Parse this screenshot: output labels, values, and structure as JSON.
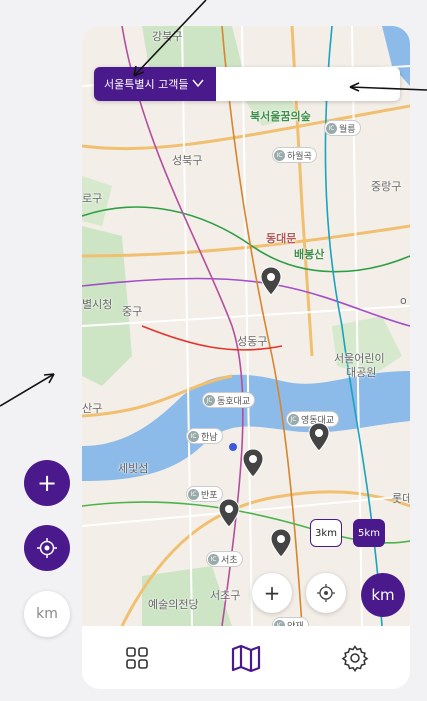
{
  "region_selector": {
    "label": "서울특별시 고객들",
    "chevron_icon": "chevron-down-icon"
  },
  "map_labels": [
    {
      "id": "gangbuk",
      "text": "강북구"
    },
    {
      "id": "seongbuk",
      "text": "성북구"
    },
    {
      "id": "jongno",
      "text": "로구"
    },
    {
      "id": "jungnang",
      "text": "중랑구"
    },
    {
      "id": "dongdaemun",
      "text": "동대문"
    },
    {
      "id": "baebongsan",
      "text": "배봉산"
    },
    {
      "id": "cityhall",
      "text": "별시청"
    },
    {
      "id": "junggu",
      "text": "중구"
    },
    {
      "id": "seongdong",
      "text": "성동구"
    },
    {
      "id": "childpark",
      "text": "서울어린이"
    },
    {
      "id": "childpark2",
      "text": "대공원"
    },
    {
      "id": "yongsan",
      "text": "산구"
    },
    {
      "id": "sebitseom",
      "text": "세빛섬"
    },
    {
      "id": "seocho",
      "text": "서초구"
    },
    {
      "id": "artscenter",
      "text": "예술의전당"
    },
    {
      "id": "lotte",
      "text": "롯데"
    },
    {
      "id": "bukseoul",
      "text": "북서울꿈의숲"
    },
    {
      "id": "o_label",
      "text": "o"
    }
  ],
  "ic_labels": [
    {
      "id": "wolgye",
      "text": "월릉"
    },
    {
      "id": "hawolgok",
      "text": "하월곡"
    },
    {
      "id": "dongho",
      "text": "동호대교"
    },
    {
      "id": "yeongdong",
      "text": "영동대교"
    },
    {
      "id": "hannam",
      "text": "한남"
    },
    {
      "id": "banpo",
      "text": "반포"
    },
    {
      "id": "seocho_ic",
      "text": "서초"
    },
    {
      "id": "yangjae",
      "text": "양재"
    }
  ],
  "radius_options": {
    "r3": "3km",
    "r5": "5km",
    "selected": "5km"
  },
  "controls": {
    "zoom_in": "+",
    "km_label": "km"
  },
  "bottom_nav": [
    {
      "id": "grid",
      "icon": "grid-icon"
    },
    {
      "id": "map",
      "icon": "map-icon",
      "active": true
    },
    {
      "id": "settings",
      "icon": "gear-icon"
    }
  ],
  "side_buttons": {
    "add": "+",
    "km": "km"
  },
  "colors": {
    "accent": "#4a1a8c",
    "river": "#7fb0e8",
    "park": "#c8e2c0"
  }
}
